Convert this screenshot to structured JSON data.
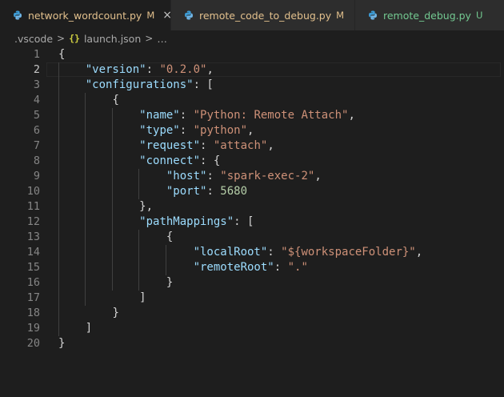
{
  "tabs": [
    {
      "filename": "network_wordcount.py",
      "badge": "M",
      "close": "×"
    },
    {
      "filename": "remote_code_to_debug.py",
      "badge": "M"
    },
    {
      "filename": "remote_debug.py",
      "badge": "U"
    }
  ],
  "breadcrumb": {
    "folder": ".vscode",
    "sep": ">",
    "braces": "{}",
    "file": "launch.json",
    "sep2": ">",
    "ellipsis": "…"
  },
  "colors": {
    "modified": "#e2c08d",
    "untracked": "#73c991",
    "key": "#9cdcfe",
    "string": "#ce9178",
    "number": "#b5cea8"
  },
  "editor": {
    "line_numbers": [
      "1",
      "2",
      "3",
      "4",
      "5",
      "6",
      "7",
      "8",
      "9",
      "10",
      "11",
      "12",
      "13",
      "14",
      "15",
      "16",
      "17",
      "18",
      "19",
      "20"
    ],
    "current_line": 2,
    "code": {
      "l1": {
        "p1": "{"
      },
      "l2": {
        "k": "\"version\"",
        "p1": ": ",
        "s": "\"0.2.0\"",
        "p2": ","
      },
      "l3": {
        "k": "\"configurations\"",
        "p1": ": ["
      },
      "l4": {
        "p1": "{"
      },
      "l5": {
        "k": "\"name\"",
        "p1": ": ",
        "s": "\"Python: Remote Attach\"",
        "p2": ","
      },
      "l6": {
        "k": "\"type\"",
        "p1": ": ",
        "s": "\"python\"",
        "p2": ","
      },
      "l7": {
        "k": "\"request\"",
        "p1": ": ",
        "s": "\"attach\"",
        "p2": ","
      },
      "l8": {
        "k": "\"connect\"",
        "p1": ": {"
      },
      "l9": {
        "k": "\"host\"",
        "p1": ": ",
        "s": "\"spark-exec-2\"",
        "p2": ","
      },
      "l10": {
        "k": "\"port\"",
        "p1": ": ",
        "n": "5680"
      },
      "l11": {
        "p1": "},"
      },
      "l12": {
        "k": "\"pathMappings\"",
        "p1": ": ["
      },
      "l13": {
        "p1": "{"
      },
      "l14": {
        "k": "\"localRoot\"",
        "p1": ": ",
        "s": "\"${workspaceFolder}\"",
        "p2": ","
      },
      "l15": {
        "k": "\"remoteRoot\"",
        "p1": ": ",
        "s": "\".\""
      },
      "l16": {
        "p1": "}"
      },
      "l17": {
        "p1": "]"
      },
      "l18": {
        "p1": "}"
      },
      "l19": {
        "p1": "]"
      },
      "l20": {
        "p1": "}"
      }
    }
  }
}
